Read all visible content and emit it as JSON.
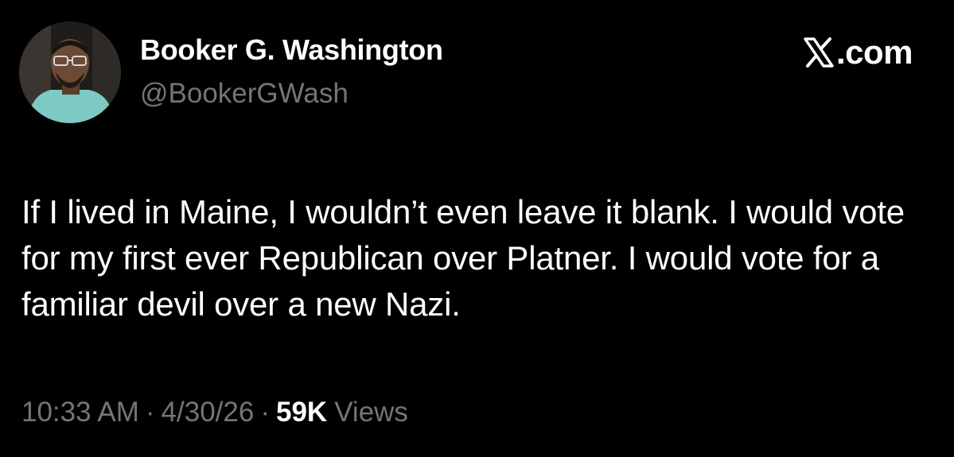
{
  "author": {
    "name": "Booker G. Washington",
    "handle": "@BookerGWash"
  },
  "site": {
    "label": ".com",
    "icon": "x-logo-icon"
  },
  "tweet": {
    "text": "If I lived in Maine, I wouldn’t even leave it blank. I would vote for my first ever Republican over Platner. I would vote for a familiar devil over a new Nazi."
  },
  "meta": {
    "time": "10:33 AM",
    "separator": "·",
    "date": "4/30/26",
    "views_count": "59K",
    "views_label": "Views"
  },
  "colors": {
    "background": "#000000",
    "primary_text": "#ffffff",
    "secondary_text": "#71767b"
  }
}
